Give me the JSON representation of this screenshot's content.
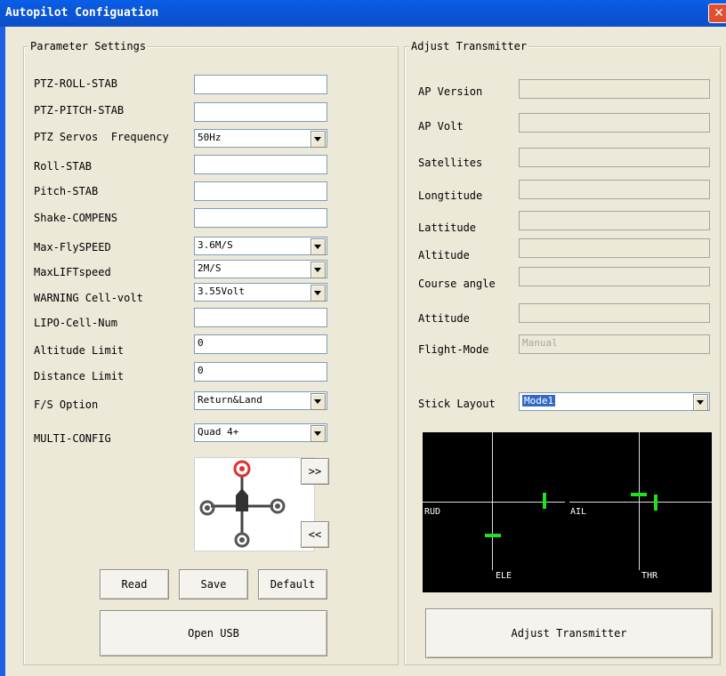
{
  "window": {
    "title": "Autopilot Configuation",
    "close_glyph": "✕"
  },
  "parameter_settings": {
    "legend": "Parameter Settings",
    "rows": [
      {
        "label": "PTZ-ROLL-STAB",
        "value": ""
      },
      {
        "label": "PTZ-PITCH-STAB",
        "value": ""
      },
      {
        "label": "PTZ Servos  Frequency",
        "value": "50Hz"
      },
      {
        "label": "Roll-STAB",
        "value": ""
      },
      {
        "label": "Pitch-STAB",
        "value": ""
      },
      {
        "label": "Shake-COMPENS",
        "value": ""
      },
      {
        "label": "Max-FlySPEED",
        "value": "3.6M/S"
      },
      {
        "label": "MaxLIFTspeed",
        "value": "2M/S"
      },
      {
        "label": "WARNING Cell-volt",
        "value": "3.55Volt"
      },
      {
        "label": "LIPO-Cell-Num",
        "value": ""
      },
      {
        "label": "Altitude Limit",
        "value": "0"
      },
      {
        "label": "Distance Limit",
        "value": "0"
      },
      {
        "label": "F/S Option",
        "value": "Return&Land"
      },
      {
        "label": "MULTI-CONFIG",
        "value": "Quad 4+"
      }
    ],
    "next_button": ">>",
    "prev_button": "<<",
    "read_button": "Read",
    "save_button": "Save",
    "default_button": "Default",
    "open_usb_button": "Open USB"
  },
  "adjust_transmitter": {
    "legend": "Adjust Transmitter",
    "rows": [
      {
        "label": "AP Version",
        "value": ""
      },
      {
        "label": "AP Volt",
        "value": ""
      },
      {
        "label": "Satellites",
        "value": ""
      },
      {
        "label": "Longtitude",
        "value": ""
      },
      {
        "label": "Lattitude",
        "value": ""
      },
      {
        "label": "Altitude",
        "value": ""
      },
      {
        "label": "Course angle",
        "value": ""
      },
      {
        "label": "Attitude",
        "value": ""
      },
      {
        "label": "Flight-Mode",
        "value": "Manual"
      }
    ],
    "stick_layout_label": "Stick Layout",
    "stick_layout_value": "Mode1",
    "stick_labels": {
      "rud": "RUD",
      "ail": "AIL",
      "ele": "ELE",
      "thr": "THR"
    },
    "adjust_button": "Adjust Transmitter"
  },
  "colors": {
    "titlebar": "#0b56d8",
    "indicator": "#20e020",
    "selection": "#316ac5",
    "rotor_active": "#e03030"
  }
}
